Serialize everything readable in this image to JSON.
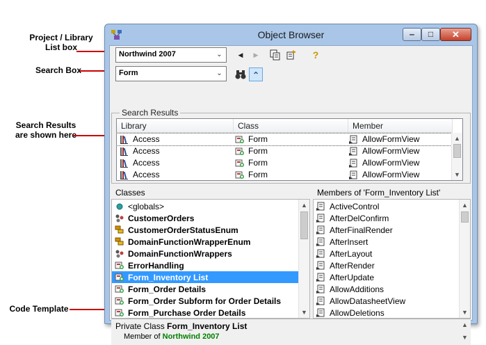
{
  "callouts": {
    "project_library": "Project / Library\nList box",
    "search_box": "Search Box",
    "search_results": "Search Results\nare shown here",
    "code_template": "Code Template"
  },
  "window": {
    "title": "Object Browser",
    "minimize": "‒",
    "maximize": "□",
    "close": "✕"
  },
  "toolbar": {
    "library_combo": "Northwind 2007",
    "search_combo": "Form",
    "back": "◀",
    "forward": "▶",
    "copy": "⎘",
    "view_definition": "⇶",
    "help": "?",
    "search": "⚲",
    "toggle_results": "⌃"
  },
  "search_results": {
    "group_label": "Search Results",
    "columns": [
      "Library",
      "Class",
      "Member"
    ],
    "rows": [
      {
        "library": "Access",
        "class": "Form",
        "member": "AllowFormView"
      },
      {
        "library": "Access",
        "class": "Form",
        "member": "AllowFormView"
      },
      {
        "library": "Access",
        "class": "Form",
        "member": "AllowFormView"
      },
      {
        "library": "Access",
        "class": "Form",
        "member": "AllowFormView"
      }
    ]
  },
  "classes": {
    "title": "Classes",
    "items": [
      {
        "label": "<globals>",
        "icon": "globe-icon",
        "bold": false
      },
      {
        "label": "CustomerOrders",
        "icon": "module-icon",
        "bold": true
      },
      {
        "label": "CustomerOrderStatusEnum",
        "icon": "enum-icon",
        "bold": true
      },
      {
        "label": "DomainFunctionWrapperEnum",
        "icon": "enum-icon",
        "bold": true
      },
      {
        "label": "DomainFunctionWrappers",
        "icon": "module-icon",
        "bold": true
      },
      {
        "label": "ErrorHandling",
        "icon": "class-icon",
        "bold": true
      },
      {
        "label": "Form_Inventory List",
        "icon": "form-icon",
        "bold": true
      },
      {
        "label": "Form_Order Details",
        "icon": "form-icon",
        "bold": true
      },
      {
        "label": "Form_Order Subform for Order Details",
        "icon": "form-icon",
        "bold": true
      },
      {
        "label": "Form_Purchase Order Details",
        "icon": "form-icon",
        "bold": true
      }
    ]
  },
  "members": {
    "title": "Members of 'Form_Inventory List'",
    "items": [
      "ActiveControl",
      "AfterDelConfirm",
      "AfterFinalRender",
      "AfterInsert",
      "AfterLayout",
      "AfterRender",
      "AfterUpdate",
      "AllowAdditions",
      "AllowDatasheetView",
      "AllowDeletions"
    ]
  },
  "details": {
    "prefix": "Private Class ",
    "name": "Form_Inventory List",
    "member_of": "Member of ",
    "library": "Northwind 2007"
  },
  "colors": {
    "selection": "#3399ff",
    "library_link": "#008000",
    "callout_line": "#cc0000"
  }
}
